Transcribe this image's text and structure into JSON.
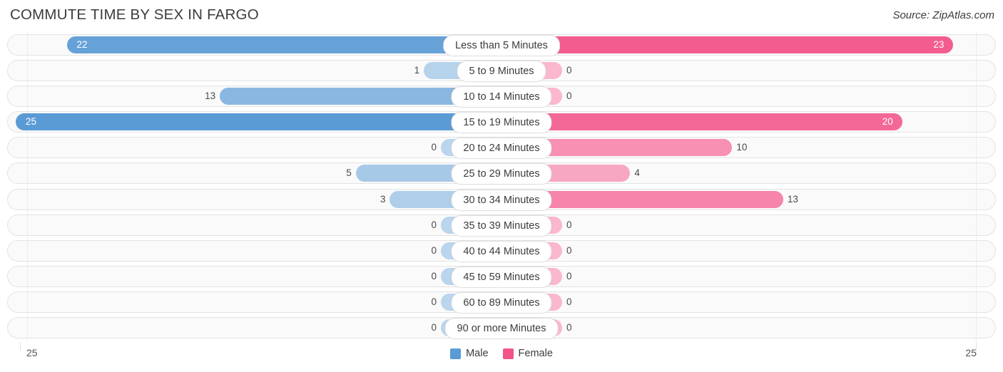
{
  "header": {
    "title": "COMMUTE TIME BY SEX IN FARGO",
    "source": "Source: ZipAtlas.com"
  },
  "legend": {
    "male_label": "Male",
    "female_label": "Female",
    "male_color": "#5b9bd5",
    "female_color": "#f2548a"
  },
  "axis": {
    "left_max": "25",
    "right_max": "25"
  },
  "chart_data": {
    "type": "bar",
    "orientation": "horizontal-diverging",
    "title": "COMMUTE TIME BY SEX IN FARGO",
    "xlabel": "",
    "ylabel": "",
    "xlim": [
      25,
      25
    ],
    "grid": false,
    "legend_position": "bottom-center",
    "categories": [
      "Less than 5 Minutes",
      "5 to 9 Minutes",
      "10 to 14 Minutes",
      "15 to 19 Minutes",
      "20 to 24 Minutes",
      "25 to 29 Minutes",
      "30 to 34 Minutes",
      "35 to 39 Minutes",
      "40 to 44 Minutes",
      "45 to 59 Minutes",
      "60 to 89 Minutes",
      "90 or more Minutes"
    ],
    "series": [
      {
        "name": "Male",
        "values": [
          22,
          1,
          13,
          25,
          0,
          5,
          3,
          0,
          0,
          0,
          0,
          0
        ]
      },
      {
        "name": "Female",
        "values": [
          23,
          0,
          0,
          20,
          10,
          4,
          13,
          0,
          0,
          0,
          0,
          0
        ]
      }
    ]
  },
  "rows": [
    {
      "label": "Less than 5 Minutes",
      "male": "22",
      "female": "23"
    },
    {
      "label": "5 to 9 Minutes",
      "male": "1",
      "female": "0"
    },
    {
      "label": "10 to 14 Minutes",
      "male": "13",
      "female": "0"
    },
    {
      "label": "15 to 19 Minutes",
      "male": "25",
      "female": "20"
    },
    {
      "label": "20 to 24 Minutes",
      "male": "0",
      "female": "10"
    },
    {
      "label": "25 to 29 Minutes",
      "male": "5",
      "female": "4"
    },
    {
      "label": "30 to 34 Minutes",
      "male": "3",
      "female": "13"
    },
    {
      "label": "35 to 39 Minutes",
      "male": "0",
      "female": "0"
    },
    {
      "label": "40 to 44 Minutes",
      "male": "0",
      "female": "0"
    },
    {
      "label": "45 to 59 Minutes",
      "male": "0",
      "female": "0"
    },
    {
      "label": "60 to 89 Minutes",
      "male": "0",
      "female": "0"
    },
    {
      "label": "90 or more Minutes",
      "male": "0",
      "female": "0"
    }
  ]
}
